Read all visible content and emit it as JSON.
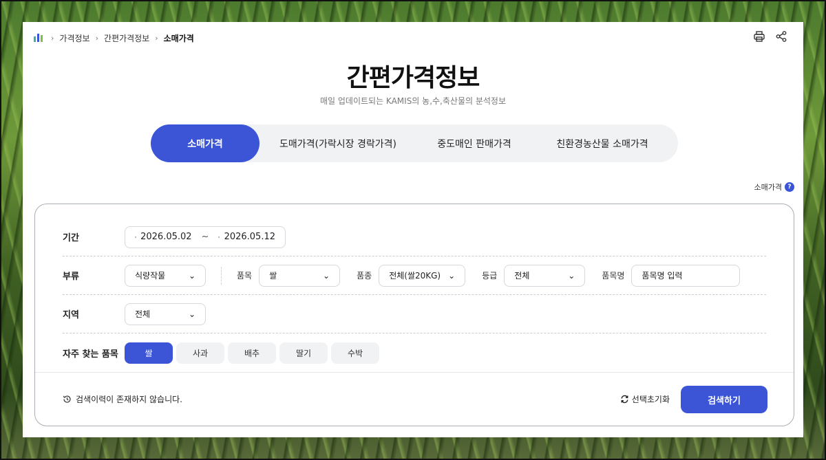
{
  "breadcrumb": [
    "가격정보",
    "간편가격정보",
    "소매가격"
  ],
  "page": {
    "title": "간편가격정보",
    "subtitle": "매일 업데이트되는 KAMIS의 농,수,축산물의 분석정보"
  },
  "tabs": [
    {
      "label": "소매가격",
      "active": true
    },
    {
      "label": "도매가격(가락시장 경락가격)",
      "active": false
    },
    {
      "label": "중도매인 판매가격",
      "active": false
    },
    {
      "label": "친환경농산물 소매가격",
      "active": false
    }
  ],
  "help_label": "소매가격",
  "form": {
    "period": {
      "label": "기간",
      "start": "2026.05.02",
      "tilde": "~",
      "end": "2026.05.12"
    },
    "category": {
      "label": "부류",
      "value": "식량작물",
      "item_label": "품목",
      "item_value": "쌀",
      "variety_label": "품종",
      "variety_value": "전체(쌀20KG)",
      "grade_label": "등급",
      "grade_value": "전체",
      "name_label": "품목명",
      "name_placeholder": "품목명 입력"
    },
    "region": {
      "label": "지역",
      "value": "전체"
    },
    "frequent": {
      "label": "자주 찾는 품목",
      "items": [
        "쌀",
        "사과",
        "배추",
        "딸기",
        "수박"
      ]
    }
  },
  "footer": {
    "history": "검색이력이 존재하지 않습니다.",
    "reset": "선택초기화",
    "search": "검색하기"
  },
  "colors": {
    "accent": "#3b55d6",
    "chip_bg": "#f1f2f4"
  }
}
